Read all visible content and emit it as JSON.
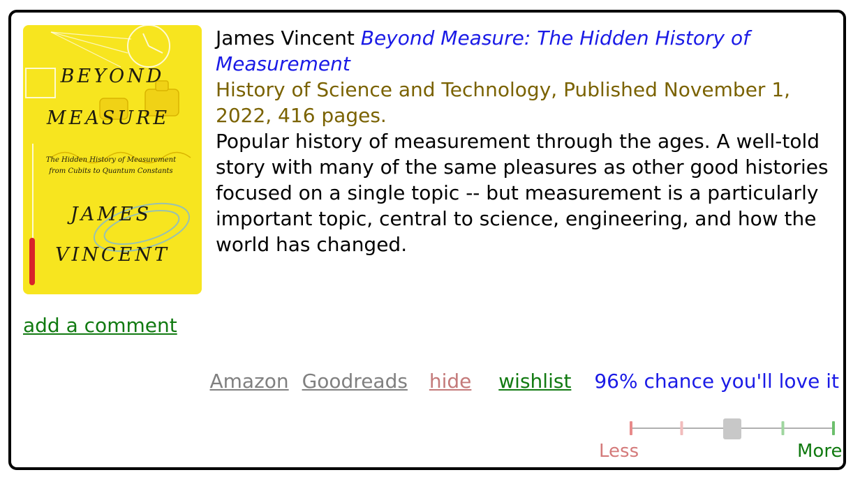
{
  "book": {
    "author": "James Vincent",
    "title": "Beyond Measure: The Hidden History of Measurement",
    "meta": "History of Science and Technology, Published November 1, 2022, 416 pages.",
    "description": "Popular history of measurement through the ages. A well-told story with many of the same pleasures as other good histories focused on a single topic -- but measurement is a particularly important topic, central to science, engineering, and how the world has changed."
  },
  "cover": {
    "title_line1": "BEYOND",
    "title_line2": "MEASURE",
    "subtitle_line1": "The Hidden History of Measurement",
    "subtitle_line2": "from Cubits to Quantum Constants",
    "author_line1": "JAMES",
    "author_line2": "VINCENT",
    "background_color": "#f7e51f"
  },
  "comment": {
    "label": "add a comment"
  },
  "actions": {
    "amazon": "Amazon",
    "goodreads": "Goodreads",
    "hide": "hide",
    "wishlist": "wishlist",
    "chance": "96% chance you'll love it"
  },
  "rating": {
    "less_label": "Less",
    "more_label": "More",
    "steps": 5,
    "selected_step": 3,
    "colors": {
      "strong_less": "#e88a8a",
      "less": "#f2bcbc",
      "neutral": "#c8c8c8",
      "more": "#9fd69f",
      "strong_more": "#6cbf6c"
    }
  }
}
